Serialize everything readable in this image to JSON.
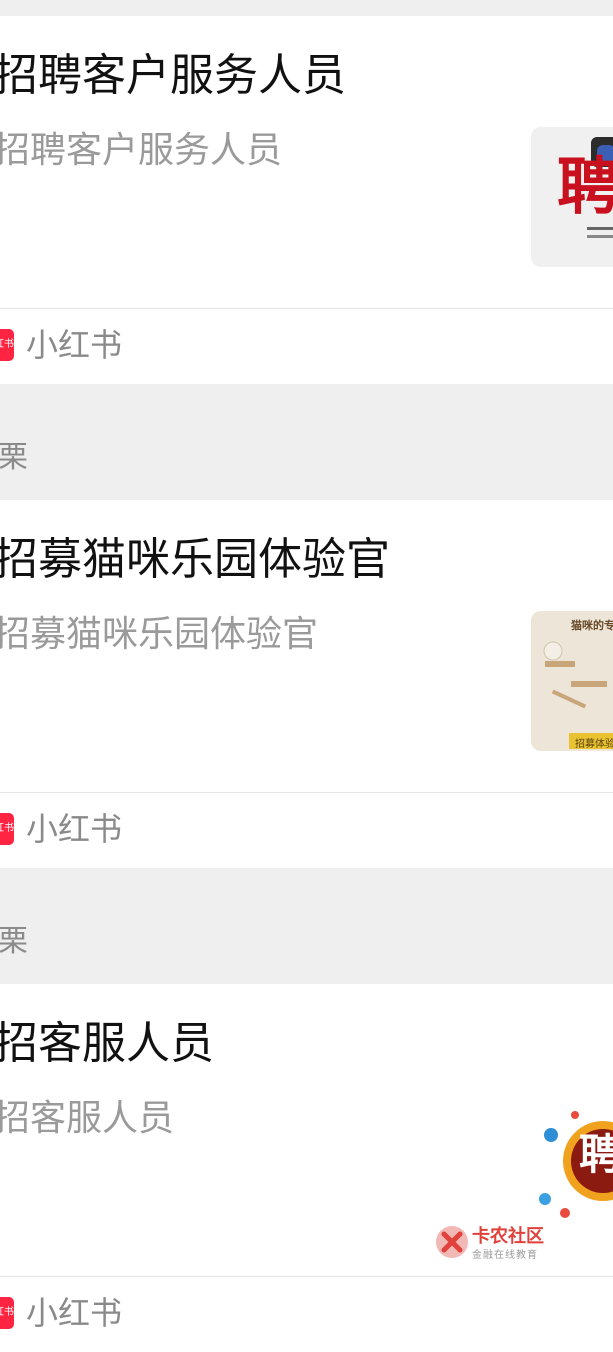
{
  "feed": {
    "items": [
      {
        "title": "招聘客户服务人员",
        "desc": "招聘客户服务人员",
        "thumb_text": "聘",
        "source_name": "小红书",
        "source_icon_text": "红书",
        "section_label": "栗"
      },
      {
        "title": "招募猫咪乐园体验官",
        "desc": "招募猫咪乐园体验官",
        "thumb_text": "猫咪的专属",
        "thumb_banner": "招募体验",
        "source_name": "小红书",
        "source_icon_text": "红书",
        "section_label": "栗"
      },
      {
        "title": "招客服人员",
        "desc": "招客服人员",
        "thumb_text": "聘",
        "source_name": "小红书",
        "source_icon_text": "红书"
      }
    ]
  },
  "watermark": {
    "name": "卡农社区",
    "subtitle": "金融在线教育"
  }
}
